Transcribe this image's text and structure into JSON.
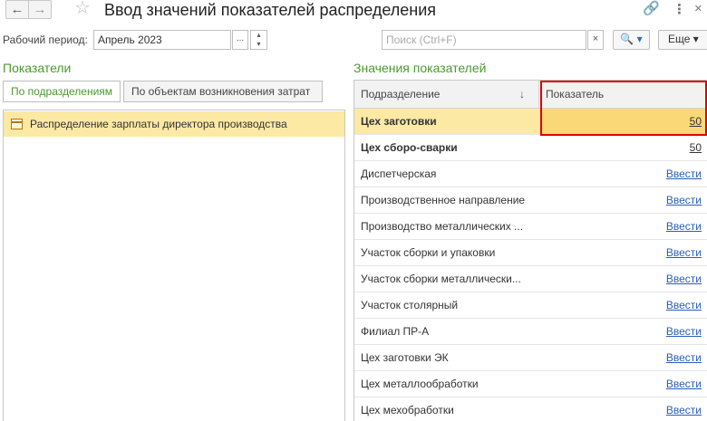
{
  "window": {
    "title": "Ввод значений показателей распределения",
    "back": "←",
    "forward": "→"
  },
  "period": {
    "label": "Рабочий период:",
    "value": "Апрель 2023",
    "dots": "..."
  },
  "search": {
    "placeholder": "Поиск (Ctrl+F)",
    "clear": "×",
    "find": "🔍 ▾",
    "more": "Еще ▾"
  },
  "left": {
    "title": "Показатели",
    "tabs": [
      {
        "label": "По подразделениям"
      },
      {
        "label": "По объектам возникновения затрат"
      }
    ],
    "items": [
      {
        "label": "Распределение зарплаты директора производства"
      }
    ]
  },
  "right": {
    "title": "Значения показателей",
    "columns": [
      "Подразделение",
      "Показатель"
    ],
    "sort": "↓",
    "rows": [
      {
        "name": "Цех заготовки",
        "value": "50"
      },
      {
        "name": "Цех сборо-сварки",
        "value": "50"
      },
      {
        "name": "Диспетчерская",
        "value": "Ввести"
      },
      {
        "name": "Производственное направление",
        "value": "Ввести"
      },
      {
        "name": "Производство металлических ...",
        "value": "Ввести"
      },
      {
        "name": "Участок сборки и упаковки",
        "value": "Ввести"
      },
      {
        "name": "Участок сборки металлически...",
        "value": "Ввести"
      },
      {
        "name": "Участок столярный",
        "value": "Ввести"
      },
      {
        "name": "Филиал ПР-А",
        "value": "Ввести"
      },
      {
        "name": "Цех заготовки ЭК",
        "value": "Ввести"
      },
      {
        "name": "Цех металлообработки",
        "value": "Ввести"
      },
      {
        "name": "Цех мехобработки",
        "value": "Ввести"
      }
    ]
  },
  "colors": {
    "accent": "#4a9a30",
    "selected": "#fbe9a4",
    "link": "#2a5fb8",
    "highlight": "#e00000"
  }
}
